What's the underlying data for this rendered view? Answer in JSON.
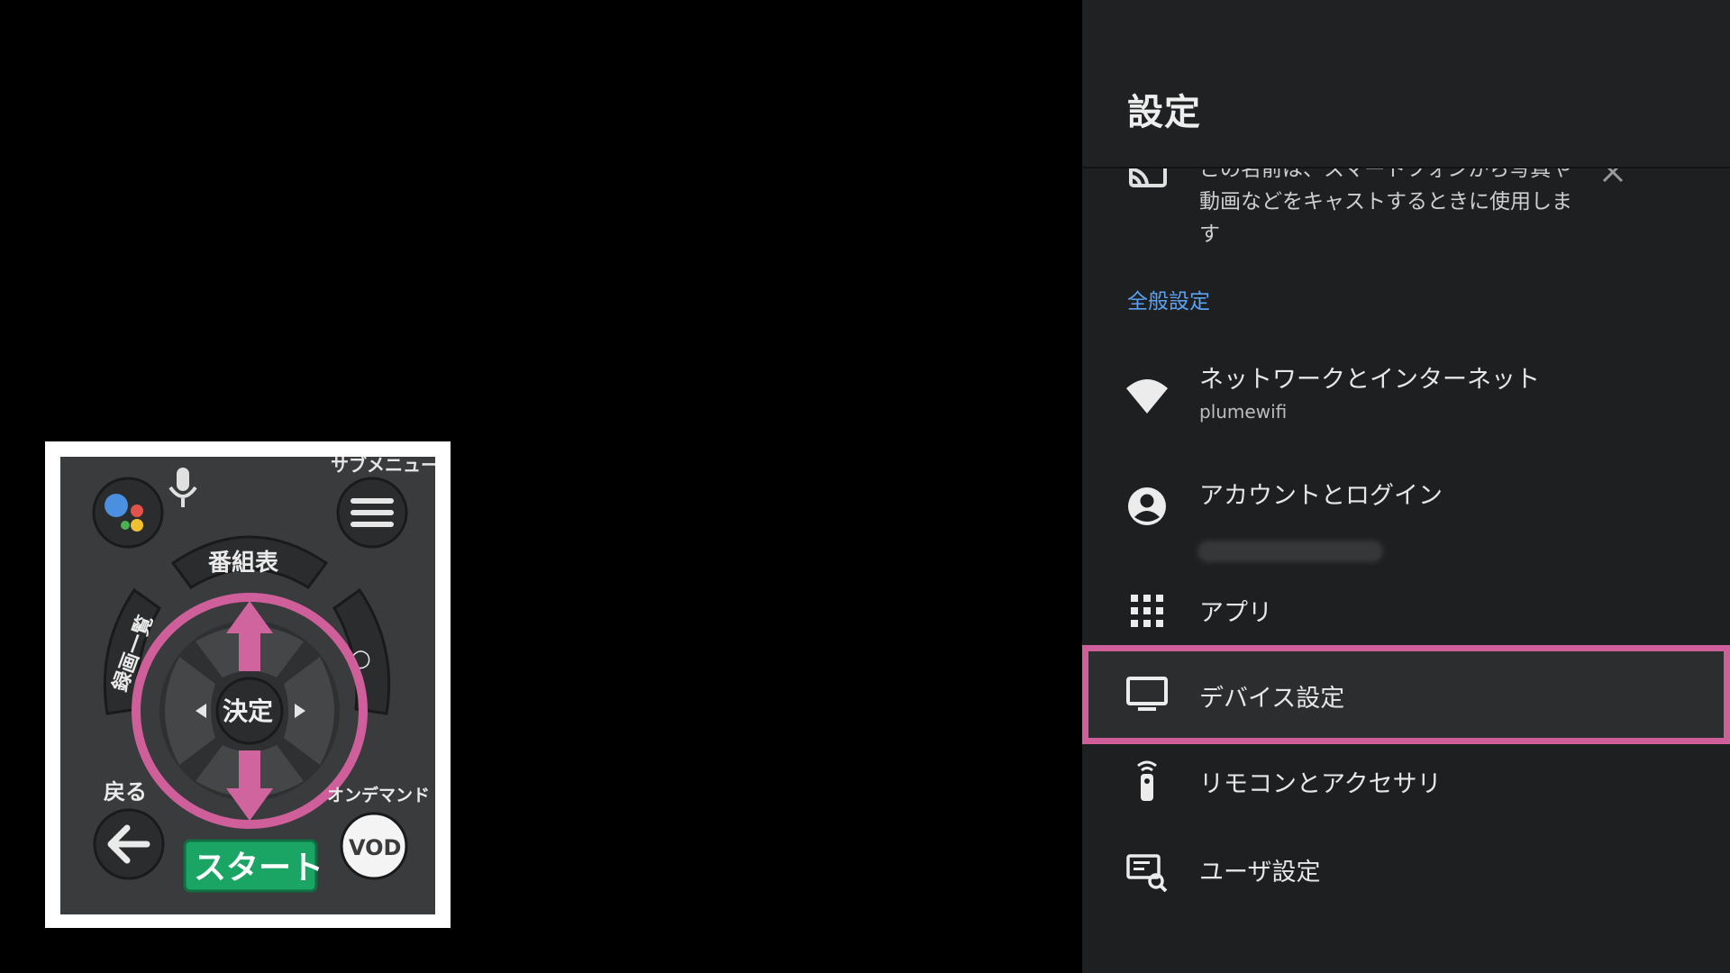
{
  "panel": {
    "title": "設定",
    "cast_notice": {
      "text": "この名前は、スマートフォンから写真や動画などをキャストするときに使用します",
      "icon": "cast-icon",
      "close_icon": "close-icon"
    },
    "section_label": "全般設定",
    "items": [
      {
        "label": "ネットワークとインターネット",
        "sub": "plumewifi",
        "icon": "wifi-icon"
      },
      {
        "label": "アカウントとログイン",
        "sub": "",
        "icon": "account-circle-icon"
      },
      {
        "label": "アプリ",
        "icon": "apps-grid-icon"
      },
      {
        "label": "デバイス設定",
        "icon": "tv-icon",
        "selected": true
      },
      {
        "label": "リモコンとアクセサリ",
        "icon": "remote-icon"
      },
      {
        "label": "ユーザ設定",
        "icon": "user-settings-icon"
      }
    ],
    "highlight_color": "#cf5f9b",
    "accent_color": "#5aa1f2"
  },
  "remote": {
    "labels": {
      "submenu": "サブメニュー",
      "guide": "番組表",
      "recorded_list": "録画一覧",
      "ok": "決定",
      "back": "戻る",
      "on_demand": "オンデマンド",
      "vod": "VOD",
      "start": "スタート",
      "circle": "○"
    },
    "annotation": "up-down arrows around d-pad",
    "annotation_color": "#cf5f9b"
  }
}
